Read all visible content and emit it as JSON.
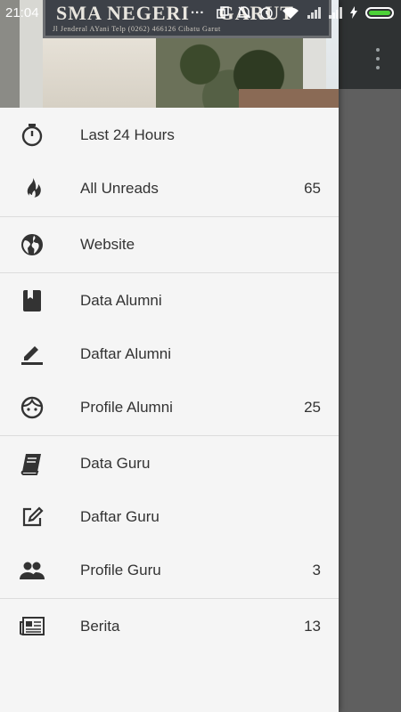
{
  "status_bar": {
    "time": "21:04",
    "dots": "..."
  },
  "header": {
    "sign_title": "SMA NEGERI",
    "sign_title_tail": "GARUT",
    "sign_address": "Jl Jenderal AYani Telp (0262) 466126 Cibatu Garut"
  },
  "menu": {
    "sections": [
      [
        {
          "label": "Last 24 Hours",
          "count": "",
          "icon": "stopwatch-icon"
        },
        {
          "label": "All Unreads",
          "count": "65",
          "icon": "fire-icon"
        }
      ],
      [
        {
          "label": "Website",
          "count": "",
          "icon": "globe-icon"
        }
      ],
      [
        {
          "label": "Data Alumni",
          "count": "",
          "icon": "book-bookmark-icon"
        },
        {
          "label": "Daftar Alumni",
          "count": "",
          "icon": "pencil-icon"
        },
        {
          "label": "Profile Alumni",
          "count": "25",
          "icon": "face-icon"
        }
      ],
      [
        {
          "label": "Data Guru",
          "count": "",
          "icon": "book-icon"
        },
        {
          "label": "Daftar Guru",
          "count": "",
          "icon": "edit-square-icon"
        },
        {
          "label": "Profile Guru",
          "count": "3",
          "icon": "people-icon"
        }
      ],
      [
        {
          "label": "Berita",
          "count": "13",
          "icon": "newspaper-icon"
        }
      ]
    ]
  }
}
